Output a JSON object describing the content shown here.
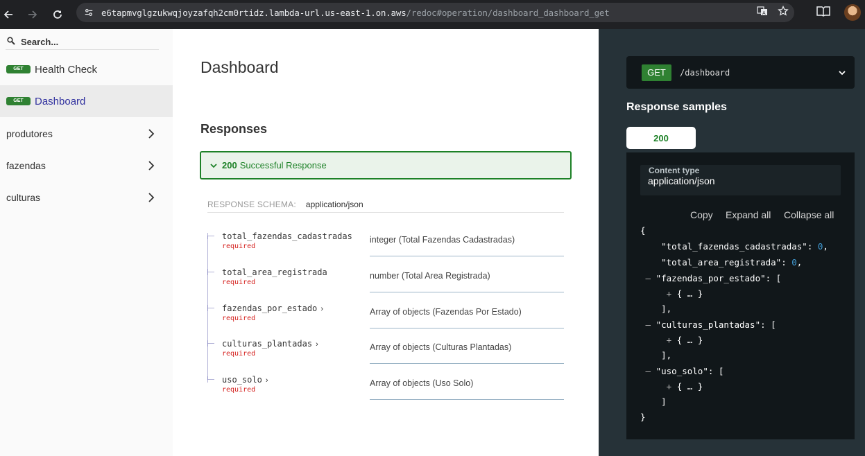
{
  "browser": {
    "url_host": "e6tapmvglgzukwqjoyzafqh2cm0rtidz.lambda-url.us-east-1.on.aws",
    "url_path": "/redoc#operation/dashboard_dashboard_get"
  },
  "sidebar": {
    "search_placeholder": "Search...",
    "items": [
      {
        "method": "GET",
        "label": "Health Check"
      },
      {
        "method": "GET",
        "label": "Dashboard"
      }
    ],
    "groups": [
      "produtores",
      "fazendas",
      "culturas"
    ]
  },
  "main": {
    "title": "Dashboard",
    "responses_heading": "Responses",
    "response": {
      "code": "200",
      "description": "Successful Response"
    },
    "schema_label": "RESPONSE SCHEMA:",
    "schema_type": "application/json",
    "properties": [
      {
        "name": "total_fazendas_cadastradas",
        "required": "required",
        "type": "integer (Total Fazendas Cadastradas)",
        "expandable": false
      },
      {
        "name": "total_area_registrada",
        "required": "required",
        "type": "number (Total Area Registrada)",
        "expandable": false
      },
      {
        "name": "fazendas_por_estado",
        "required": "required",
        "type": "Array of objects (Fazendas Por Estado)",
        "expandable": true
      },
      {
        "name": "culturas_plantadas",
        "required": "required",
        "type": "Array of objects (Culturas Plantadas)",
        "expandable": true
      },
      {
        "name": "uso_solo",
        "required": "required",
        "type": "Array of objects (Uso Solo)",
        "expandable": true
      }
    ]
  },
  "right": {
    "method": "GET",
    "path": "/dashboard",
    "samples_heading": "Response samples",
    "tab": "200",
    "content_type_label": "Content type",
    "content_type": "application/json",
    "actions": [
      "Copy",
      "Expand all",
      "Collapse all"
    ]
  },
  "colors": {
    "get_badge": "#2f8132",
    "success_green": "#1d8127",
    "active_link": "#32329f",
    "required_red": "#d41f1c",
    "number_blue": "#409bd4",
    "right_panel_bg": "#263238"
  }
}
